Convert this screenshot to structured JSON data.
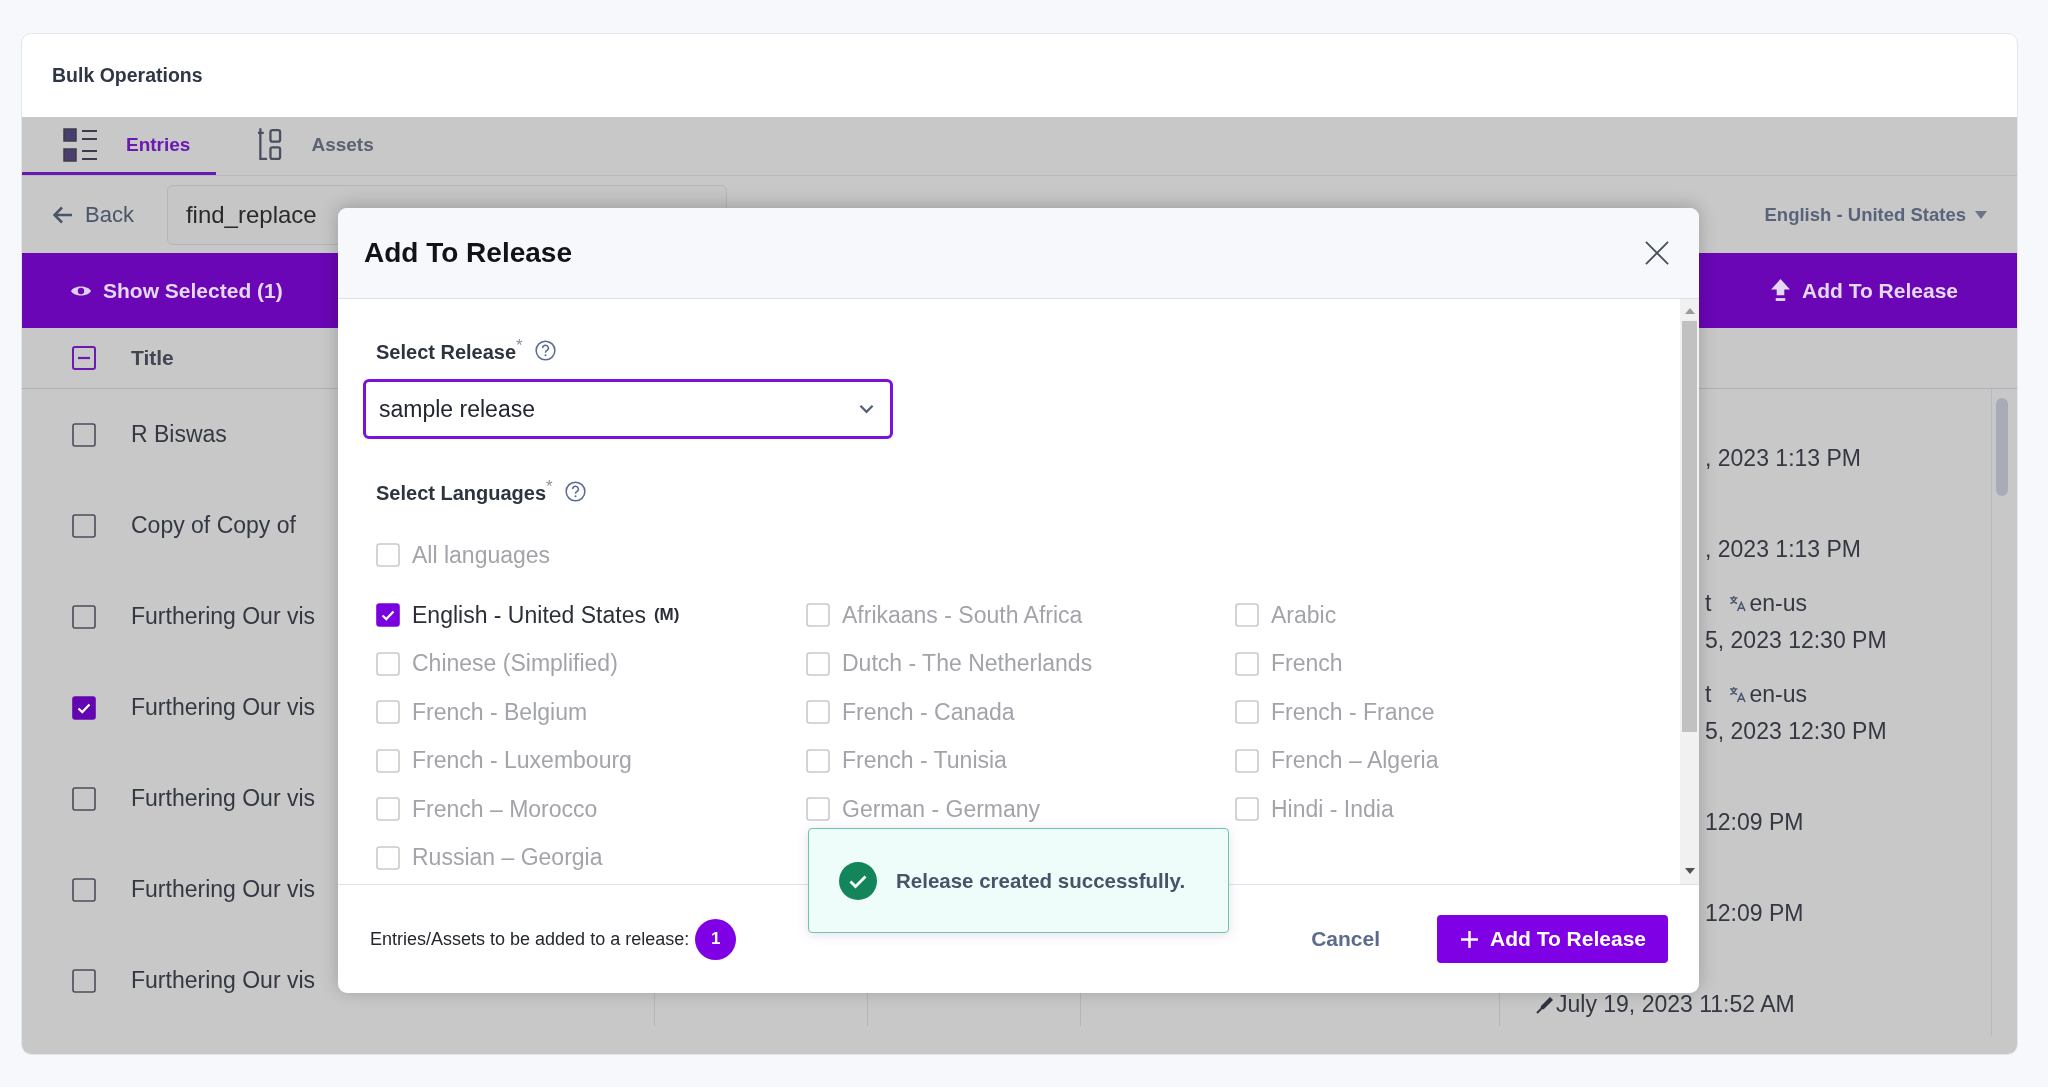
{
  "header": {
    "title": "Bulk Operations"
  },
  "tabs": [
    {
      "label": "Entries",
      "selected": true,
      "kind": "entries"
    },
    {
      "label": "Assets",
      "selected": false,
      "kind": "assets"
    }
  ],
  "toolbar": {
    "back": "Back",
    "search": {
      "value": "find_replace"
    },
    "language": "English - United States"
  },
  "action_bar": {
    "show_selected": "Show Selected (1)",
    "add_to_release": "Add To Release"
  },
  "table": {
    "select_all": {
      "checked": false,
      "indeterminate": true
    },
    "columns": [
      {
        "label": "Title"
      }
    ],
    "rows": [
      {
        "title": "R Biswas",
        "checked": false,
        "kind": "covered",
        "date": ", 2023 1:13 PM"
      },
      {
        "title": "Copy of Copy of",
        "checked": false,
        "kind": "covered",
        "date": ", 2023 1:13 PM"
      },
      {
        "title": "Furthering Our vis",
        "checked": false,
        "kind": "covered",
        "status": "t",
        "locale": "en-us",
        "date": "5, 2023 12:30 PM"
      },
      {
        "title": "Furthering Our vis",
        "checked": true,
        "kind": "covered",
        "status": "t",
        "locale": "en-us",
        "date": "5, 2023 12:30 PM"
      },
      {
        "title": "Furthering Our vis",
        "checked": false,
        "kind": "covered",
        "date": "12:09 PM"
      },
      {
        "title": "Furthering Our vis",
        "checked": false,
        "kind": "covered",
        "date": "12:09 PM"
      },
      {
        "title": "Furthering Our vis",
        "checked": false,
        "kind": "full",
        "date": "July 19, 2023 11:52 AM"
      }
    ]
  },
  "modal": {
    "title": "Add To Release",
    "release": {
      "label": "Select Release$^{*}$",
      "value": "sample release"
    },
    "languages": {
      "label": "Select Languages$^{*}$",
      "all": {
        "label": "All languages",
        "checked": false,
        "disabled": true
      },
      "items": [
        {
          "label": "English - United States",
          "tag": "(M)",
          "checked": true,
          "disabled": false
        },
        {
          "label": "Afrikaans - South Africa",
          "checked": false,
          "disabled": true
        },
        {
          "label": "Arabic",
          "checked": false,
          "disabled": true
        },
        {
          "label": "Chinese (Simplified)",
          "checked": false,
          "disabled": true
        },
        {
          "label": "Dutch - The Netherlands",
          "checked": false,
          "disabled": true
        },
        {
          "label": "French",
          "checked": false,
          "disabled": true
        },
        {
          "label": "French - Belgium",
          "checked": false,
          "disabled": true
        },
        {
          "label": "French - Canada",
          "checked": false,
          "disabled": true
        },
        {
          "label": "French - France",
          "checked": false,
          "disabled": true
        },
        {
          "label": "French - Luxembourg",
          "checked": false,
          "disabled": true
        },
        {
          "label": "French - Tunisia",
          "checked": false,
          "disabled": true
        },
        {
          "label": "French – Algeria",
          "checked": false,
          "disabled": true
        },
        {
          "label": "French – Morocco",
          "checked": false,
          "disabled": true
        },
        {
          "label": "German - Germany",
          "checked": false,
          "disabled": true
        },
        {
          "label": "Hindi - India",
          "checked": false,
          "disabled": true
        },
        {
          "label": "Russian – Georgia",
          "checked": false,
          "disabled": true
        }
      ]
    },
    "footer": {
      "count_label": "Entries/Assets to be added to a release:",
      "count": "1",
      "cancel": "Cancel",
      "submit": "Add To Release"
    }
  },
  "toast": {
    "kind": "success",
    "message": "Release created successfully."
  }
}
